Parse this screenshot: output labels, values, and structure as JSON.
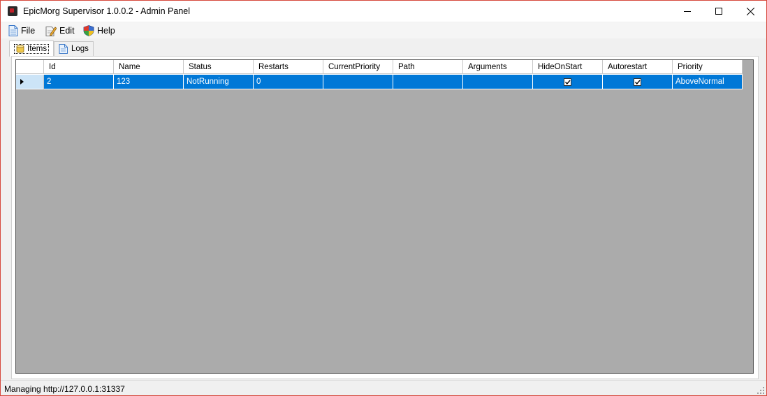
{
  "window": {
    "title": "EpicMorg Supervisor 1.0.0.2 - Admin Panel"
  },
  "menu": {
    "items": [
      {
        "label": "File",
        "icon": "document-icon"
      },
      {
        "label": "Edit",
        "icon": "edit-icon"
      },
      {
        "label": "Help",
        "icon": "shield-icon"
      }
    ]
  },
  "tabs": [
    {
      "label": "Items",
      "icon": "database-icon",
      "active": true
    },
    {
      "label": "Logs",
      "icon": "document-icon",
      "active": false
    }
  ],
  "grid": {
    "columns": [
      "Id",
      "Name",
      "Status",
      "Restarts",
      "CurrentPriority",
      "Path",
      "Arguments",
      "HideOnStart",
      "Autorestart",
      "Priority"
    ],
    "rows": [
      {
        "id": "2",
        "name": "123",
        "status": "NotRunning",
        "restarts": "0",
        "current_priority": "",
        "path": "",
        "arguments": "",
        "hide_on_start": true,
        "autorestart": true,
        "priority": "AboveNormal"
      }
    ],
    "selection_color": "#0078d7",
    "background_color": "#ababab"
  },
  "status": {
    "text": "Managing http://127.0.0.1:31337"
  }
}
